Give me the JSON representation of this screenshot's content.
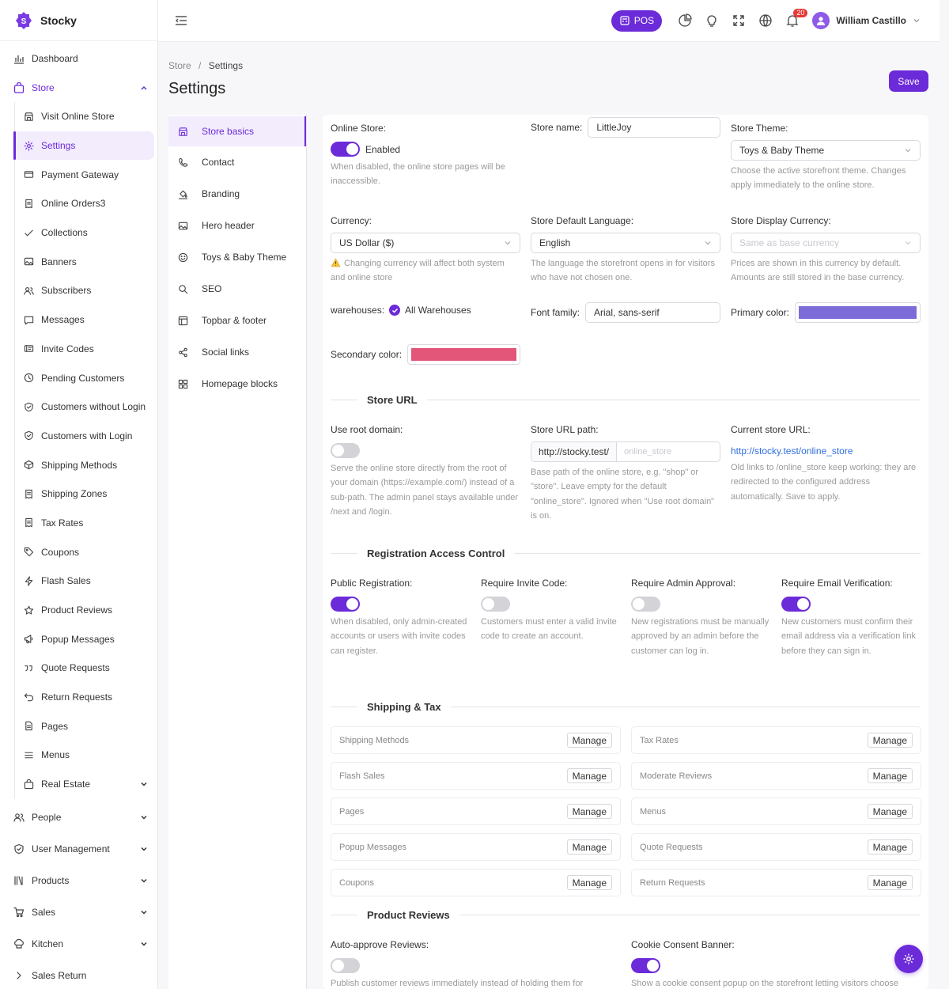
{
  "brand": {
    "name": "Stocky",
    "logo_letter": "S"
  },
  "sidebar": {
    "top": [
      {
        "label": "Dashboard",
        "icon": "bar-chart-icon"
      },
      {
        "label": "Store",
        "icon": "bag-icon"
      }
    ],
    "store_items": [
      {
        "label": "Visit Online Store",
        "icon": "storefront-icon"
      },
      {
        "label": "Settings",
        "icon": "gear-icon"
      },
      {
        "label": "Payment Gateway",
        "icon": "card-icon"
      },
      {
        "label": "Online Orders3",
        "icon": "receipt-icon"
      },
      {
        "label": "Collections",
        "icon": "check-icon"
      },
      {
        "label": "Banners",
        "icon": "image-icon"
      },
      {
        "label": "Subscribers",
        "icon": "users-icon"
      },
      {
        "label": "Messages",
        "icon": "message-icon"
      },
      {
        "label": "Invite Codes",
        "icon": "ticket-icon"
      },
      {
        "label": "Pending Customers",
        "icon": "clock-icon"
      },
      {
        "label": "Customers without Login",
        "icon": "shield-icon"
      },
      {
        "label": "Customers with Login",
        "icon": "shield-icon"
      },
      {
        "label": "Shipping Methods",
        "icon": "box-icon"
      },
      {
        "label": "Shipping Zones",
        "icon": "receipt-icon"
      },
      {
        "label": "Tax Rates",
        "icon": "receipt-icon"
      },
      {
        "label": "Coupons",
        "icon": "tag-icon"
      },
      {
        "label": "Flash Sales",
        "icon": "bolt-icon"
      },
      {
        "label": "Product Reviews",
        "icon": "star-icon"
      },
      {
        "label": "Popup Messages",
        "icon": "megaphone-icon"
      },
      {
        "label": "Quote Requests",
        "icon": "quote-icon"
      },
      {
        "label": "Return Requests",
        "icon": "return-icon"
      },
      {
        "label": "Pages",
        "icon": "page-icon"
      },
      {
        "label": "Menus",
        "icon": "menu-icon"
      },
      {
        "label": "Real Estate",
        "icon": "bag-icon"
      }
    ],
    "bottom": [
      {
        "label": "People",
        "icon": "users-icon"
      },
      {
        "label": "User Management",
        "icon": "shield-icon"
      },
      {
        "label": "Products",
        "icon": "books-icon"
      },
      {
        "label": "Sales",
        "icon": "cart-icon"
      },
      {
        "label": "Kitchen",
        "icon": "chef-icon"
      },
      {
        "label": "Sales Return",
        "icon": "chevron-right-icon"
      }
    ]
  },
  "topbar": {
    "pos_label": "POS",
    "notif_count": "20",
    "user_name": "William Castillo"
  },
  "breadcrumb": {
    "parent": "Store",
    "sep": "/",
    "current": "Settings"
  },
  "page_title": "Settings",
  "save_label": "Save",
  "settings_nav": [
    {
      "label": "Store basics",
      "icon": "storefront-icon"
    },
    {
      "label": "Contact",
      "icon": "phone-icon"
    },
    {
      "label": "Branding",
      "icon": "paint-icon"
    },
    {
      "label": "Hero header",
      "icon": "image-icon"
    },
    {
      "label": "Toys & Baby Theme",
      "icon": "smile-icon"
    },
    {
      "label": "SEO",
      "icon": "search-icon"
    },
    {
      "label": "Topbar & footer",
      "icon": "layout-icon"
    },
    {
      "label": "Social links",
      "icon": "share-icon"
    },
    {
      "label": "Homepage blocks",
      "icon": "grid-icon"
    }
  ],
  "basics": {
    "online_store_label": "Online Store:",
    "online_store_state": "Enabled",
    "online_store_help": "When disabled, the online store pages will be inaccessible.",
    "store_name_label": "Store name:",
    "store_name_value": "LittleJoy",
    "store_theme_label": "Store Theme:",
    "store_theme_value": "Toys & Baby Theme",
    "store_theme_help": "Choose the active storefront theme. Changes apply immediately to the online store.",
    "currency_label": "Currency:",
    "currency_value": "US Dollar ($)",
    "currency_help": "Changing currency will affect both system and online store",
    "language_label": "Store Default Language:",
    "language_value": "English",
    "language_help": "The language the storefront opens in for visitors who have not chosen one.",
    "display_currency_label": "Store Display Currency:",
    "display_currency_placeholder": "Same as base currency",
    "display_currency_help": "Prices are shown in this currency by default. Amounts are still stored in the base currency.",
    "warehouses_label": "warehouses:",
    "warehouses_value": "All Warehouses",
    "font_family_label": "Font family:",
    "font_family_value": "Arial, sans-serif",
    "primary_color_label": "Primary color:",
    "primary_color": "#7b6cd8",
    "secondary_color_label": "Secondary color:",
    "secondary_color": "#e4557a"
  },
  "store_url": {
    "section_title": "Store URL",
    "root_label": "Use root domain:",
    "root_help": "Serve the online store directly from the root of your domain (https://example.com/) instead of a sub-path. The admin panel stays available under /next and /login.",
    "path_label": "Store URL path:",
    "path_prefix": "http://stocky.test/",
    "path_placeholder": "online_store",
    "path_help": "Base path of the online store, e.g. \"shop\" or \"store\". Leave empty for the default \"online_store\". Ignored when \"Use root domain\" is on.",
    "current_label": "Current store URL:",
    "current_url": "http://stocky.test/online_store",
    "current_help": "Old links to /online_store keep working: they are redirected to the configured address automatically. Save to apply."
  },
  "registration": {
    "section_title": "Registration Access Control",
    "items": [
      {
        "label": "Public Registration:",
        "on": true,
        "help": "When disabled, only admin-created accounts or users with invite codes can register."
      },
      {
        "label": "Require Invite Code:",
        "on": false,
        "help": "Customers must enter a valid invite code to create an account."
      },
      {
        "label": "Require Admin Approval:",
        "on": false,
        "help": "New registrations must be manually approved by an admin before the customer can log in."
      },
      {
        "label": "Require Email Verification:",
        "on": true,
        "help": "New customers must confirm their email address via a verification link before they can sign in."
      }
    ]
  },
  "shipping_tax": {
    "section_title": "Shipping & Tax",
    "manage_label": "Manage",
    "rows": [
      [
        "Shipping Methods",
        "Tax Rates"
      ],
      [
        "Flash Sales",
        "Moderate Reviews"
      ],
      [
        "Pages",
        "Menus"
      ],
      [
        "Popup Messages",
        "Quote Requests"
      ],
      [
        "Coupons",
        "Return Requests"
      ]
    ]
  },
  "product_reviews": {
    "section_title": "Product Reviews",
    "auto_label": "Auto-approve Reviews:",
    "auto_help": "Publish customer reviews immediately instead of holding them for",
    "cookie_label": "Cookie Consent Banner:",
    "cookie_help": "Show a cookie consent popup on the storefront letting visitors choose"
  },
  "colors": {
    "accent": "#6c2bd9"
  }
}
